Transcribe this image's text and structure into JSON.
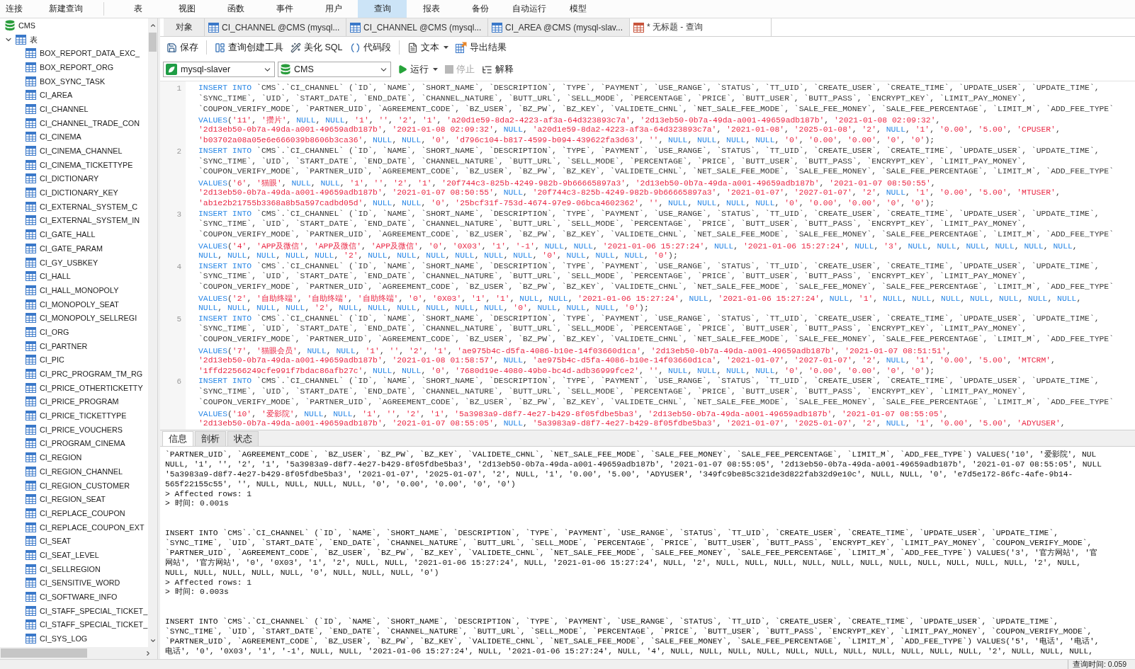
{
  "menu_bar": {
    "groups": [
      {
        "items": [
          {
            "label": "连接",
            "selected": false
          },
          {
            "label": "新建查询",
            "selected": false
          }
        ]
      },
      {
        "items": [
          {
            "label": "表",
            "selected": false
          },
          {
            "label": "视图",
            "selected": false
          },
          {
            "label": "函数",
            "selected": false
          },
          {
            "label": "事件",
            "selected": false
          },
          {
            "label": "用户",
            "selected": false
          },
          {
            "label": "查询",
            "selected": true
          },
          {
            "label": "报表",
            "selected": false
          },
          {
            "label": "备份",
            "selected": false
          },
          {
            "label": "自动运行",
            "selected": false
          },
          {
            "label": "模型",
            "selected": false
          }
        ]
      }
    ]
  },
  "sidebar": {
    "tree": [
      {
        "label": "CMS",
        "kind": "database",
        "children": [
          {
            "label": "表",
            "kind": "folder",
            "expanded": true,
            "children": [
              {
                "label": "BOX_REPORT_DATA_EXC_",
                "kind": "table"
              },
              {
                "label": "BOX_REPORT_ORG",
                "kind": "table"
              },
              {
                "label": "BOX_SYNC_TASK",
                "kind": "table"
              },
              {
                "label": "CI_AREA",
                "kind": "table"
              },
              {
                "label": "CI_CHANNEL",
                "kind": "table"
              },
              {
                "label": "CI_CHANNEL_TRADE_CON",
                "kind": "table"
              },
              {
                "label": "CI_CINEMA",
                "kind": "table"
              },
              {
                "label": "CI_CINEMA_CHANNEL",
                "kind": "table"
              },
              {
                "label": "CI_CINEMA_TICKETTYPE",
                "kind": "table"
              },
              {
                "label": "CI_DICTIONARY",
                "kind": "table"
              },
              {
                "label": "CI_DICTIONARY_KEY",
                "kind": "table"
              },
              {
                "label": "CI_EXTERNAL_SYSTEM_C",
                "kind": "table"
              },
              {
                "label": "CI_EXTERNAL_SYSTEM_IN",
                "kind": "table"
              },
              {
                "label": "CI_GATE_HALL",
                "kind": "table"
              },
              {
                "label": "CI_GATE_PARAM",
                "kind": "table"
              },
              {
                "label": "CI_GY_USBKEY",
                "kind": "table"
              },
              {
                "label": "CI_HALL",
                "kind": "table"
              },
              {
                "label": "CI_HALL_MONOPOLY",
                "kind": "table"
              },
              {
                "label": "CI_MONOPOLY_SEAT",
                "kind": "table"
              },
              {
                "label": "CI_MONOPOLY_SELLREGI",
                "kind": "table"
              },
              {
                "label": "CI_ORG",
                "kind": "table"
              },
              {
                "label": "CI_PARTNER",
                "kind": "table"
              },
              {
                "label": "CI_PIC",
                "kind": "table"
              },
              {
                "label": "CI_PRC_PROGRAM_TM_RG",
                "kind": "table"
              },
              {
                "label": "CI_PRICE_OTHERTICKETTY",
                "kind": "table"
              },
              {
                "label": "CI_PRICE_PROGRAM",
                "kind": "table"
              },
              {
                "label": "CI_PRICE_TICKETTYPE",
                "kind": "table"
              },
              {
                "label": "CI_PRICE_VOUCHERS",
                "kind": "table"
              },
              {
                "label": "CI_PROGRAM_CINEMA",
                "kind": "table"
              },
              {
                "label": "CI_REGION",
                "kind": "table"
              },
              {
                "label": "CI_REGION_CHANNEL",
                "kind": "table"
              },
              {
                "label": "CI_REGION_CUSTOMER",
                "kind": "table"
              },
              {
                "label": "CI_REGION_SEAT",
                "kind": "table"
              },
              {
                "label": "CI_REPLACE_COUPON",
                "kind": "table"
              },
              {
                "label": "CI_REPLACE_COUPON_EXT",
                "kind": "table"
              },
              {
                "label": "CI_SEAT",
                "kind": "table"
              },
              {
                "label": "CI_SEAT_LEVEL",
                "kind": "table"
              },
              {
                "label": "CI_SELLREGION",
                "kind": "table"
              },
              {
                "label": "CI_SENSITIVE_WORD",
                "kind": "table"
              },
              {
                "label": "CI_SOFTWARE_INFO",
                "kind": "table"
              },
              {
                "label": "CI_STAFF_SPECIAL_TICKET_",
                "kind": "table"
              },
              {
                "label": "CI_STAFF_SPECIAL_TICKET_",
                "kind": "table"
              },
              {
                "label": "CI_SYS_LOG",
                "kind": "table"
              }
            ]
          }
        ]
      }
    ]
  },
  "tabs": [
    {
      "label": "对象",
      "kind": "objects",
      "selected": false
    },
    {
      "label": "CI_CHANNEL @CMS (mysql...",
      "kind": "table",
      "selected": false
    },
    {
      "label": "CI_CHANNEL @CMS (mysql...",
      "kind": "table",
      "selected": false
    },
    {
      "label": "CI_AREA @CMS (mysql-slav...",
      "kind": "table",
      "selected": false
    },
    {
      "label": "* 无标题 - 查询",
      "kind": "query",
      "selected": true
    }
  ],
  "toolbar": {
    "groups": [
      {
        "items": [
          {
            "label": "保存",
            "kind": "save",
            "dropdown": false
          }
        ]
      },
      {
        "items": [
          {
            "label": "查询创建工具",
            "kind": "builder",
            "dropdown": false
          },
          {
            "label": "美化 SQL",
            "kind": "beautify",
            "dropdown": false
          },
          {
            "label": "代码段",
            "kind": "snippet",
            "dropdown": false
          }
        ]
      },
      {
        "items": [
          {
            "label": "文本",
            "kind": "text",
            "dropdown": true
          },
          {
            "label": "导出结果",
            "kind": "export",
            "dropdown": false
          }
        ]
      }
    ]
  },
  "run_bar": {
    "connection": {
      "value": "mysql-slaver"
    },
    "database": {
      "value": "CMS"
    },
    "buttons": [
      {
        "label": "运行",
        "kind": "run",
        "dropdown": true,
        "disabled": false
      },
      {
        "label": "停止",
        "kind": "stop",
        "dropdown": false,
        "disabled": true
      },
      {
        "label": "解释",
        "kind": "explain",
        "dropdown": false,
        "disabled": false
      }
    ]
  },
  "editor": {
    "statements": [
      {
        "number": "1",
        "lines": [
          "INSERT INTO `CMS`.`CI_CHANNEL` (`ID`, `NAME`, `SHORT_NAME`, `DESCRIPTION`, `TYPE`, `PAYMENT`, `USE_RANGE`, `STATUS`, `TT_UID`, `CREATE_USER`, `CREATE_TIME`, `UPDATE_USER`, `UPDATE_TIME`,",
          "`SYNC_TIME`, `UID`, `START_DATE`, `END_DATE`, `CHANNEL_NATURE`, `BUTT_URL`, `SELL_MODE`, `PERCENTAGE`, `PRICE`, `BUTT_USER`, `BUTT_PASS`, `ENCRYPT_KEY`, `LIMIT_PAY_MONEY`,",
          "`COUPON_VERIFY_MODE`, `PARTNER_UID`, `AGREEMENT_CODE`, `BZ_USER`, `BZ_PW`, `BZ_KEY`, `VALIDETE_CHNL`, `NET_SALE_FEE_MODE`, `SALE_FEE_MONEY`, `SALE_FEE_PERCENTAGE`, `LIMIT_M`, `ADD_FEE_TYPE`",
          "VALUES('11', '攒片', NULL, NULL, '1', '', '2', '1', 'a20d1e59-8da2-4223-af3a-64d323893c7a', '2d13eb50-0b7a-49da-a001-49659adb187b', '2021-01-08 02:09:32',",
          "'2d13eb50-0b7a-49da-a001-49659adb187b', '2021-01-08 02:09:32', NULL, 'a20d1e59-8da2-4223-af3a-64d323893c7a', '2021-01-08', '2025-01-08', '2', NULL, '1', '0.00', '5.00', 'CPUSER',",
          "'b03702a08a05e6e666039b8606b3ca36', NULL, NULL, '0', 'd796c104-b817-4599-b094-439622fa3d63', '', NULL, NULL, NULL, NULL, '0', '0.00', '0.00', '0', '0');"
        ]
      },
      {
        "number": "2",
        "lines": [
          "INSERT INTO `CMS`.`CI_CHANNEL` (`ID`, `NAME`, `SHORT_NAME`, `DESCRIPTION`, `TYPE`, `PAYMENT`, `USE_RANGE`, `STATUS`, `TT_UID`, `CREATE_USER`, `CREATE_TIME`, `UPDATE_USER`, `UPDATE_TIME`,",
          "`SYNC_TIME`, `UID`, `START_DATE`, `END_DATE`, `CHANNEL_NATURE`, `BUTT_URL`, `SELL_MODE`, `PERCENTAGE`, `PRICE`, `BUTT_USER`, `BUTT_PASS`, `ENCRYPT_KEY`, `LIMIT_PAY_MONEY`,",
          "`COUPON_VERIFY_MODE`, `PARTNER_UID`, `AGREEMENT_CODE`, `BZ_USER`, `BZ_PW`, `BZ_KEY`, `VALIDETE_CHNL`, `NET_SALE_FEE_MODE`, `SALE_FEE_MONEY`, `SALE_FEE_PERCENTAGE`, `LIMIT_M`, `ADD_FEE_TYPE`",
          "VALUES('6', '猫眼', NULL, NULL, '1', '', '2', '1', '20f744c3-825b-4249-982b-9b66665897a3', '2d13eb50-0b7a-49da-a001-49659adb187b', '2021-01-07 08:50:55',",
          "'2d13eb50-0b7a-49da-a001-49659adb187b', '2021-01-07 08:50:55', NULL, '20f744c3-825b-4249-982b-9b66665897a3', '2021-01-07', '2027-01-07', '2', NULL, '1', '0.00', '5.00', 'MTUSER',",
          "'ab1e2b21755b3368a8b5a597cadbd05d', NULL, NULL, '0', '25bcf31f-753d-4674-97e9-06bca4602362', '', NULL, NULL, NULL, NULL, '0', '0.00', '0.00', '0', '0');"
        ]
      },
      {
        "number": "3",
        "lines": [
          "INSERT INTO `CMS`.`CI_CHANNEL` (`ID`, `NAME`, `SHORT_NAME`, `DESCRIPTION`, `TYPE`, `PAYMENT`, `USE_RANGE`, `STATUS`, `TT_UID`, `CREATE_USER`, `CREATE_TIME`, `UPDATE_USER`, `UPDATE_TIME`,",
          "`SYNC_TIME`, `UID`, `START_DATE`, `END_DATE`, `CHANNEL_NATURE`, `BUTT_URL`, `SELL_MODE`, `PERCENTAGE`, `PRICE`, `BUTT_USER`, `BUTT_PASS`, `ENCRYPT_KEY`, `LIMIT_PAY_MONEY`,",
          "`COUPON_VERIFY_MODE`, `PARTNER_UID`, `AGREEMENT_CODE`, `BZ_USER`, `BZ_PW`, `BZ_KEY`, `VALIDETE_CHNL`, `NET_SALE_FEE_MODE`, `SALE_FEE_MONEY`, `SALE_FEE_PERCENTAGE`, `LIMIT_M`, `ADD_FEE_TYPE`",
          "VALUES('4', 'APP及微信', 'APP及微信', 'APP及微信', '0', '0X03', '1', '-1', NULL, NULL, '2021-01-06 15:27:24', NULL, '2021-01-06 15:27:24', NULL, '3', NULL, NULL, NULL, NULL, NULL, NULL,",
          "NULL, NULL, NULL, NULL, NULL, '2', NULL, NULL, NULL, NULL, NULL, NULL, '0', NULL, NULL, NULL, '0');"
        ]
      },
      {
        "number": "4",
        "lines": [
          "INSERT INTO `CMS`.`CI_CHANNEL` (`ID`, `NAME`, `SHORT_NAME`, `DESCRIPTION`, `TYPE`, `PAYMENT`, `USE_RANGE`, `STATUS`, `TT_UID`, `CREATE_USER`, `CREATE_TIME`, `UPDATE_USER`, `UPDATE_TIME`,",
          "`SYNC_TIME`, `UID`, `START_DATE`, `END_DATE`, `CHANNEL_NATURE`, `BUTT_URL`, `SELL_MODE`, `PERCENTAGE`, `PRICE`, `BUTT_USER`, `BUTT_PASS`, `ENCRYPT_KEY`, `LIMIT_PAY_MONEY`,",
          "`COUPON_VERIFY_MODE`, `PARTNER_UID`, `AGREEMENT_CODE`, `BZ_USER`, `BZ_PW`, `BZ_KEY`, `VALIDETE_CHNL`, `NET_SALE_FEE_MODE`, `SALE_FEE_MONEY`, `SALE_FEE_PERCENTAGE`, `LIMIT_M`, `ADD_FEE_TYPE`",
          "VALUES('2', '自助终端', '自助终端', '自助终端', '0', '0X03', '1', '1', NULL, NULL, '2021-01-06 15:27:24', NULL, '2021-01-06 15:27:24', NULL, '1', NULL, NULL, NULL, NULL, NULL, NULL, NULL,",
          "NULL, NULL, NULL, NULL, '2', NULL, NULL, NULL, NULL, NULL, NULL, '0', NULL, NULL, NULL, '0');"
        ]
      },
      {
        "number": "5",
        "lines": [
          "INSERT INTO `CMS`.`CI_CHANNEL` (`ID`, `NAME`, `SHORT_NAME`, `DESCRIPTION`, `TYPE`, `PAYMENT`, `USE_RANGE`, `STATUS`, `TT_UID`, `CREATE_USER`, `CREATE_TIME`, `UPDATE_USER`, `UPDATE_TIME`,",
          "`SYNC_TIME`, `UID`, `START_DATE`, `END_DATE`, `CHANNEL_NATURE`, `BUTT_URL`, `SELL_MODE`, `PERCENTAGE`, `PRICE`, `BUTT_USER`, `BUTT_PASS`, `ENCRYPT_KEY`, `LIMIT_PAY_MONEY`,",
          "`COUPON_VERIFY_MODE`, `PARTNER_UID`, `AGREEMENT_CODE`, `BZ_USER`, `BZ_PW`, `BZ_KEY`, `VALIDETE_CHNL`, `NET_SALE_FEE_MODE`, `SALE_FEE_MONEY`, `SALE_FEE_PERCENTAGE`, `LIMIT_M`, `ADD_FEE_TYPE`",
          "VALUES('7', '猫眼会员', NULL, NULL, '1', '', '2', '1', 'ae975b4c-d5fa-4086-b10e-14f03660d1ca', '2d13eb50-0b7a-49da-a001-49659adb187b', '2021-01-07 08:51:51',",
          "'2d13eb50-0b7a-49da-a001-49659adb187b', '2021-01-08 01:58:57', NULL, 'ae975b4c-d5fa-4086-b10e-14f03660d1ca', '2021-01-07', '2027-01-07', '2', NULL, '1', '0.00', '5.00', 'MTCRM',",
          "'1ffd22566249cfe991f7bdac86afb27c', NULL, NULL, '0', '7680d19e-4080-49b0-bc4d-adb36999fce2', '', NULL, NULL, NULL, NULL, '0', '0.00', '0.00', '0', '0');"
        ]
      },
      {
        "number": "6",
        "lines": [
          "INSERT INTO `CMS`.`CI_CHANNEL` (`ID`, `NAME`, `SHORT_NAME`, `DESCRIPTION`, `TYPE`, `PAYMENT`, `USE_RANGE`, `STATUS`, `TT_UID`, `CREATE_USER`, `CREATE_TIME`, `UPDATE_USER`, `UPDATE_TIME`,",
          "`SYNC_TIME`, `UID`, `START_DATE`, `END_DATE`, `CHANNEL_NATURE`, `BUTT_URL`, `SELL_MODE`, `PERCENTAGE`, `PRICE`, `BUTT_USER`, `BUTT_PASS`, `ENCRYPT_KEY`, `LIMIT_PAY_MONEY`,",
          "`COUPON_VERIFY_MODE`, `PARTNER_UID`, `AGREEMENT_CODE`, `BZ_USER`, `BZ_PW`, `BZ_KEY`, `VALIDETE_CHNL`, `NET_SALE_FEE_MODE`, `SALE_FEE_MONEY`, `SALE_FEE_PERCENTAGE`, `LIMIT_M`, `ADD_FEE_TYPE`",
          "VALUES('10', '爱影院', NULL, NULL, '1', '', '2', '1', '5a3983a9-d8f7-4e27-b429-8f05fdbe5ba3', '2d13eb50-0b7a-49da-a001-49659adb187b', '2021-01-07 08:55:05',",
          "'2d13eb50-0b7a-49da-a001-49659adb187b', '2021-01-07 08:55:05', NULL, '5a3983a9-d8f7-4e27-b429-8f05fdbe5ba3', '2021-01-07', '2025-01-07', '2', NULL, '1', '0.00', '5.00', 'ADYUSER',"
        ]
      }
    ]
  },
  "output_panel": {
    "tabs": [
      {
        "label": "信息",
        "selected": true
      },
      {
        "label": "剖析",
        "selected": false
      },
      {
        "label": "状态",
        "selected": false
      }
    ],
    "messages": [
      {
        "lines": [
          "`PARTNER_UID`, `AGREEMENT_CODE`, `BZ_USER`, `BZ_PW`, `BZ_KEY`, `VALIDETE_CHNL`, `NET_SALE_FEE_MODE`, `SALE_FEE_MONEY`, `SALE_FEE_PERCENTAGE`, `LIMIT_M`, `ADD_FEE_TYPE`) VALUES('10', '爱影院', NUL",
          "NULL, '1', '', '2', '1', '5a3983a9-d8f7-4e27-b429-8f05fdbe5ba3', '2d13eb50-0b7a-49da-a001-49659adb187b', '2021-01-07 08:55:05', '2d13eb50-0b7a-49da-a001-49659adb187b', '2021-01-07 08:55:05', NULL",
          "'5a3983a9-d8f7-4e27-b429-8f05fdbe5ba3', '2021-01-07', '2025-01-07', '2', NULL, '1', '0.00', '5.00', 'ADYUSER', '349fc9be85c321de3d822fab32d9e10c', NULL, NULL, '0', 'e7d5e172-86fc-4afe-9b14-",
          "565f22155c55', '', NULL, NULL, NULL, NULL, '0', '0.00', '0.00', '0', '0')",
          "> Affected rows: 1",
          "> 时间: 0.001s"
        ]
      },
      {
        "lines": [
          "INSERT INTO `CMS`.`CI_CHANNEL` (`ID`, `NAME`, `SHORT_NAME`, `DESCRIPTION`, `TYPE`, `PAYMENT`, `USE_RANGE`, `STATUS`, `TT_UID`, `CREATE_USER`, `CREATE_TIME`, `UPDATE_USER`, `UPDATE_TIME`,",
          "`SYNC_TIME`, `UID`, `START_DATE`, `END_DATE`, `CHANNEL_NATURE`, `BUTT_URL`, `SELL_MODE`, `PERCENTAGE`, `PRICE`, `BUTT_USER`, `BUTT_PASS`, `ENCRYPT_KEY`, `LIMIT_PAY_MONEY`, `COUPON_VERIFY_MODE`,",
          "`PARTNER_UID`, `AGREEMENT_CODE`, `BZ_USER`, `BZ_PW`, `BZ_KEY`, `VALIDETE_CHNL`, `NET_SALE_FEE_MODE`, `SALE_FEE_MONEY`, `SALE_FEE_PERCENTAGE`, `LIMIT_M`, `ADD_FEE_TYPE`) VALUES('3', '官方网站', '官",
          "网站', '官方网站', '0', '0X03', '1', '2', NULL, NULL, '2021-01-06 15:27:24', NULL, '2021-01-06 15:27:24', NULL, '2', NULL, NULL, NULL, NULL, NULL, NULL, NULL, NULL, NULL, NULL, NULL, '2', NULL,",
          "NULL, NULL, NULL, NULL, NULL, '0', NULL, NULL, NULL, '0')",
          "> Affected rows: 1",
          "> 时间: 0.003s"
        ]
      },
      {
        "lines": [
          "INSERT INTO `CMS`.`CI_CHANNEL` (`ID`, `NAME`, `SHORT_NAME`, `DESCRIPTION`, `TYPE`, `PAYMENT`, `USE_RANGE`, `STATUS`, `TT_UID`, `CREATE_USER`, `CREATE_TIME`, `UPDATE_USER`, `UPDATE_TIME`,",
          "`SYNC_TIME`, `UID`, `START_DATE`, `END_DATE`, `CHANNEL_NATURE`, `BUTT_URL`, `SELL_MODE`, `PERCENTAGE`, `PRICE`, `BUTT_USER`, `BUTT_PASS`, `ENCRYPT_KEY`, `LIMIT_PAY_MONEY`, `COUPON_VERIFY_MODE`,",
          "`PARTNER_UID`, `AGREEMENT_CODE`, `BZ_USER`, `BZ_PW`, `BZ_KEY`, `VALIDETE_CHNL`, `NET_SALE_FEE_MODE`, `SALE_FEE_MONEY`, `SALE_FEE_PERCENTAGE`, `LIMIT_M`, `ADD_FEE_TYPE`) VALUES('5', '电话', '电话',",
          "电话', '0', '0X03', '1', '-1', NULL, NULL, '2021-01-06 15:27:24', NULL, '2021-01-06 15:27:24', NULL, '4', NULL, NULL, NULL, NULL, NULL, NULL, NULL, NULL, NULL, NULL, NULL, '2', NULL, NULL, NULL,"
        ]
      }
    ]
  },
  "status_bar": {
    "query_time": "查询时间: 0.059"
  }
}
